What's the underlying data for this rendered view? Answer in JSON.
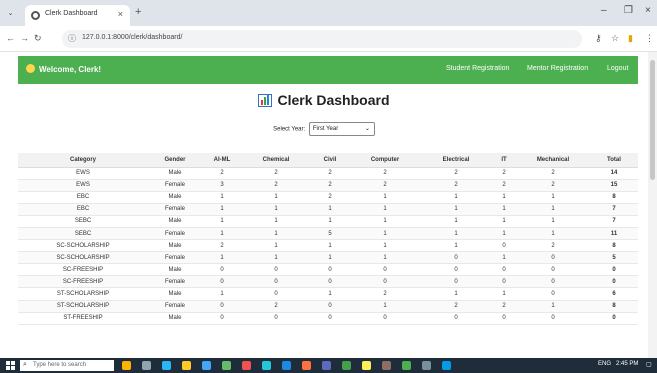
{
  "browser": {
    "tab_title": "Clerk Dashboard",
    "url": "127.0.0.1:8000/clerk/dashboard/"
  },
  "navbar": {
    "welcome": "Welcome, Clerk!",
    "links": [
      "Student Registration",
      "Mentor Registration",
      "Logout"
    ]
  },
  "dashboard": {
    "title": "Clerk Dashboard",
    "year_label": "Select Year:",
    "year_value": "First Year"
  },
  "table": {
    "headers": [
      "Category",
      "Gender",
      "AI-ML",
      "Chemical",
      "Civil",
      "Computer",
      "Electrical",
      "IT",
      "Mechanical",
      "Total"
    ],
    "rows": [
      [
        "EWS",
        "Male",
        "2",
        "2",
        "2",
        "2",
        "2",
        "2",
        "2",
        "14"
      ],
      [
        "EWS",
        "Female",
        "3",
        "2",
        "2",
        "2",
        "2",
        "2",
        "2",
        "15"
      ],
      [
        "EBC",
        "Male",
        "1",
        "1",
        "2",
        "1",
        "1",
        "1",
        "1",
        "8"
      ],
      [
        "EBC",
        "Female",
        "1",
        "1",
        "1",
        "1",
        "1",
        "1",
        "1",
        "7"
      ],
      [
        "SEBC",
        "Male",
        "1",
        "1",
        "1",
        "1",
        "1",
        "1",
        "1",
        "7"
      ],
      [
        "SEBC",
        "Female",
        "1",
        "1",
        "5",
        "1",
        "1",
        "1",
        "1",
        "11"
      ],
      [
        "SC-SCHOLARSHIP",
        "Male",
        "2",
        "1",
        "1",
        "1",
        "1",
        "0",
        "2",
        "8"
      ],
      [
        "SC-SCHOLARSHIP",
        "Female",
        "1",
        "1",
        "1",
        "1",
        "0",
        "1",
        "0",
        "5"
      ],
      [
        "SC-FREESHIP",
        "Male",
        "0",
        "0",
        "0",
        "0",
        "0",
        "0",
        "0",
        "0"
      ],
      [
        "SC-FREESHIP",
        "Female",
        "0",
        "0",
        "0",
        "0",
        "0",
        "0",
        "0",
        "0"
      ],
      [
        "ST-SCHOLARSHIP",
        "Male",
        "1",
        "0",
        "1",
        "2",
        "1",
        "1",
        "0",
        "6"
      ],
      [
        "ST-SCHOLARSHIP",
        "Female",
        "0",
        "2",
        "0",
        "1",
        "2",
        "2",
        "1",
        "8"
      ],
      [
        "ST-FREESHIP",
        "Male",
        "0",
        "0",
        "0",
        "0",
        "0",
        "0",
        "0",
        "0"
      ]
    ]
  },
  "taskbar": {
    "search_placeholder": "Type here to search",
    "tray_text": "ENG",
    "time": "2:45 PM"
  },
  "colors": {
    "navbar": "#4caf50",
    "taskbar": "#1f2d3a"
  }
}
